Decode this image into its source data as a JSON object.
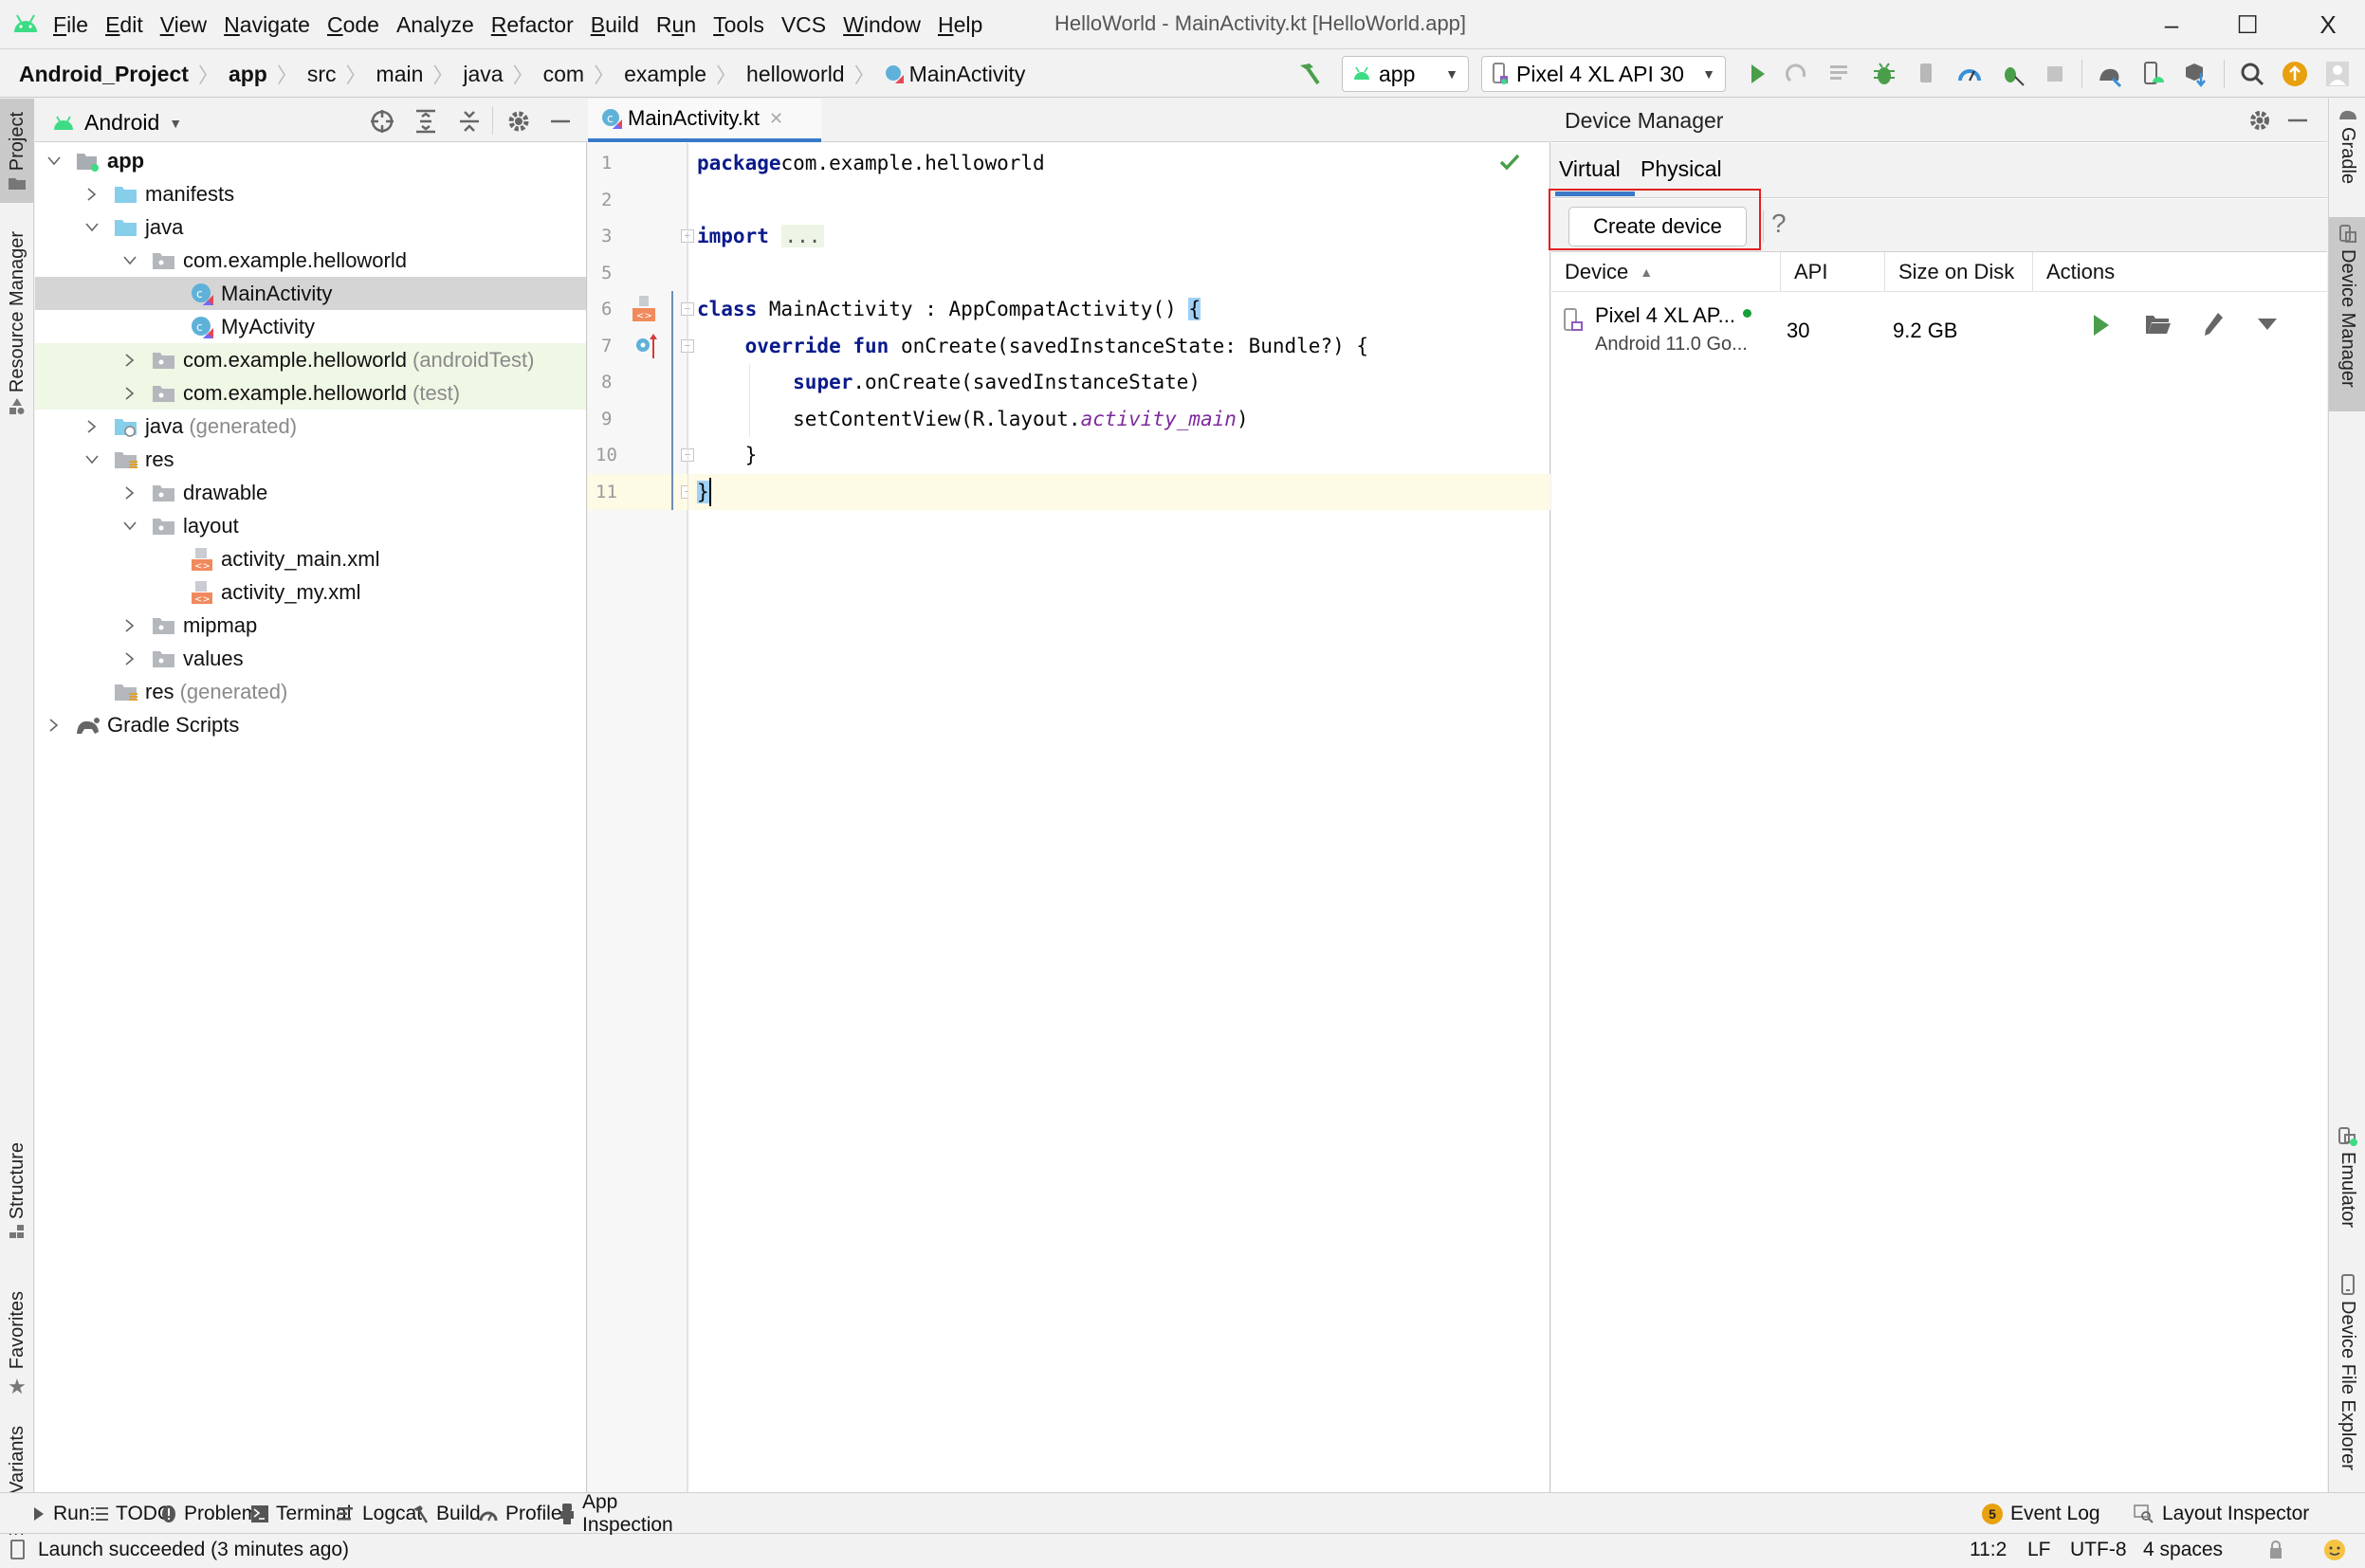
{
  "menu": {
    "items": [
      "File",
      "Edit",
      "View",
      "Navigate",
      "Code",
      "Analyze",
      "Refactor",
      "Build",
      "Run",
      "Tools",
      "VCS",
      "Window",
      "Help"
    ],
    "mnemonics": [
      0,
      0,
      0,
      0,
      0,
      -1,
      0,
      0,
      1,
      0,
      -1,
      0,
      0
    ]
  },
  "window": {
    "title": "HelloWorld - MainActivity.kt [HelloWorld.app]",
    "minimize": "–",
    "maximize": "☐",
    "close": "X"
  },
  "breadcrumb": {
    "items": [
      "Android_Project",
      "app",
      "src",
      "main",
      "java",
      "com",
      "example",
      "helloworld",
      "MainActivity"
    ],
    "separator": "〉"
  },
  "toolbar": {
    "run_config": "app",
    "device": "Pixel 4 XL API 30"
  },
  "left_stripe": {
    "project": "Project",
    "resource_manager": "Resource Manager",
    "structure": "Structure",
    "favorites": "Favorites",
    "build_variants": "Build Variants"
  },
  "right_stripe": {
    "gradle": "Gradle",
    "device_manager": "Device Manager",
    "emulator": "Emulator",
    "device_file_explorer": "Device File Explorer"
  },
  "project": {
    "view_mode": "Android",
    "tree": [
      {
        "label": "app",
        "suffix": "",
        "level": 0,
        "expanded": true,
        "icon": "module-folder",
        "bold": true
      },
      {
        "label": "manifests",
        "suffix": "",
        "level": 1,
        "expanded": false,
        "icon": "source-folder"
      },
      {
        "label": "java",
        "suffix": "",
        "level": 1,
        "expanded": true,
        "icon": "source-folder"
      },
      {
        "label": "com.example.helloworld",
        "suffix": "",
        "level": 2,
        "expanded": true,
        "icon": "package"
      },
      {
        "label": "MainActivity",
        "suffix": "",
        "level": 3,
        "icon": "kotlin-class",
        "selected": true
      },
      {
        "label": "MyActivity",
        "suffix": "",
        "level": 3,
        "icon": "kotlin-class"
      },
      {
        "label": "com.example.helloworld",
        "suffix": "(androidTest)",
        "level": 2,
        "expanded": false,
        "icon": "package",
        "test": true
      },
      {
        "label": "com.example.helloworld",
        "suffix": "(test)",
        "level": 2,
        "expanded": false,
        "icon": "package",
        "test": true
      },
      {
        "label": "java",
        "suffix": "(generated)",
        "level": 1,
        "expanded": false,
        "icon": "generated-folder"
      },
      {
        "label": "res",
        "suffix": "",
        "level": 1,
        "expanded": true,
        "icon": "res-folder"
      },
      {
        "label": "drawable",
        "suffix": "",
        "level": 2,
        "expanded": false,
        "icon": "package"
      },
      {
        "label": "layout",
        "suffix": "",
        "level": 2,
        "expanded": true,
        "icon": "package"
      },
      {
        "label": "activity_main.xml",
        "suffix": "",
        "level": 3,
        "icon": "xml-file"
      },
      {
        "label": "activity_my.xml",
        "suffix": "",
        "level": 3,
        "icon": "xml-file"
      },
      {
        "label": "mipmap",
        "suffix": "",
        "level": 2,
        "expanded": false,
        "icon": "package"
      },
      {
        "label": "values",
        "suffix": "",
        "level": 2,
        "expanded": false,
        "icon": "package"
      },
      {
        "label": "res",
        "suffix": "(generated)",
        "level": 1,
        "icon": "res-folder"
      },
      {
        "label": "Gradle Scripts",
        "suffix": "",
        "level": 0,
        "expanded": false,
        "icon": "gradle"
      }
    ]
  },
  "editor": {
    "tab": "MainActivity.kt",
    "lines": [
      {
        "n": "1",
        "code": [
          [
            "kw",
            "package"
          ],
          [
            "",
            "com.example.helloworld"
          ]
        ]
      },
      {
        "n": "2",
        "code": []
      },
      {
        "n": "3",
        "code": [
          [
            "kw",
            "import"
          ],
          [
            "",
            " "
          ],
          [
            "fold",
            "..."
          ]
        ]
      },
      {
        "n": "5",
        "code": []
      },
      {
        "n": "6",
        "code": [
          [
            "kw",
            "class"
          ],
          [
            "",
            " MainActivity : AppCompatActivity() "
          ],
          [
            "brace",
            "{"
          ]
        ]
      },
      {
        "n": "7",
        "code": [
          [
            "",
            "    "
          ],
          [
            "kw",
            "override fun"
          ],
          [
            "",
            " onCreate(savedInstanceState: Bundle?) {"
          ]
        ]
      },
      {
        "n": "8",
        "code": [
          [
            "",
            "        "
          ],
          [
            "kw",
            "super"
          ],
          [
            "",
            ".onCreate(savedInstanceState)"
          ]
        ]
      },
      {
        "n": "9",
        "code": [
          [
            "",
            "        setContentView(R.layout."
          ],
          [
            "it",
            "activity_main"
          ],
          [
            "",
            ")"
          ]
        ]
      },
      {
        "n": "10",
        "code": [
          [
            "",
            "    }"
          ]
        ]
      },
      {
        "n": "11",
        "code": [
          [
            "brace",
            "}"
          ]
        ],
        "current": true
      }
    ]
  },
  "device_manager": {
    "title": "Device Manager",
    "tabs": [
      "Virtual",
      "Physical"
    ],
    "active_tab": 0,
    "create_button": "Create device",
    "help": "?",
    "columns": [
      "Device",
      "API",
      "Size on Disk",
      "Actions"
    ],
    "devices": [
      {
        "name": "Pixel 4 XL AP...",
        "subtitle": "Android 11.0 Go...",
        "api": "30",
        "size": "9.2 GB",
        "online": true
      }
    ]
  },
  "bottom_tools": {
    "left": [
      "Run",
      "TODO",
      "Problems",
      "Terminal",
      "Logcat",
      "Build",
      "Profiler",
      "App Inspection"
    ],
    "event_log": "Event Log",
    "event_log_count": "5",
    "layout_inspector": "Layout Inspector"
  },
  "status": {
    "message": "Launch succeeded (3 minutes ago)",
    "position": "11:2",
    "line_sep": "LF",
    "encoding": "UTF-8",
    "indent": "4 spaces"
  },
  "colors": {
    "accent": "#3a79c8",
    "android_green": "#3ddc84",
    "run_green": "#4a9e4a",
    "highlight_red": "#e02020",
    "event_badge": "#e8a00e"
  }
}
